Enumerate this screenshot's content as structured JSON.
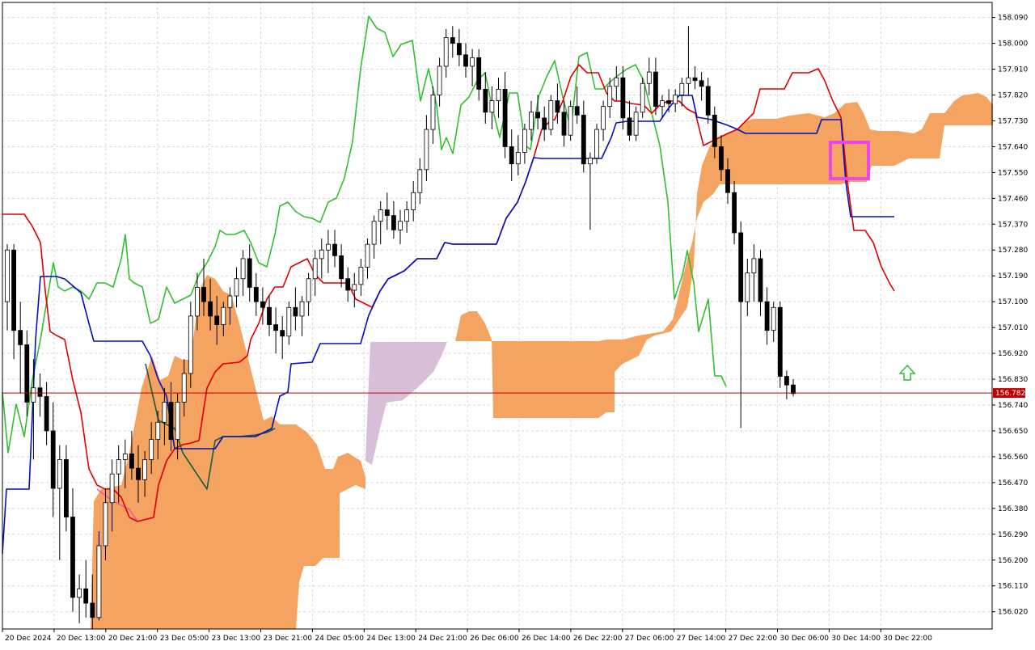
{
  "chart_data": {
    "type": "candlestick",
    "indicator": "ichimoku",
    "price_axis": {
      "ylim": [
        155.96,
        158.11
      ],
      "ticks": [
        "158.090",
        "158.000",
        "157.910",
        "157.820",
        "157.730",
        "157.640",
        "157.550",
        "157.460",
        "157.370",
        "157.280",
        "157.190",
        "157.100",
        "157.010",
        "156.920",
        "156.830",
        "156.740",
        "156.650",
        "156.560",
        "156.470",
        "156.380",
        "156.290",
        "156.200",
        "156.110",
        "156.020"
      ]
    },
    "time_axis": {
      "labels": [
        "20 Dec 2024",
        "20 Dec 13:00",
        "20 Dec 21:00",
        "23 Dec 05:00",
        "23 Dec 13:00",
        "23 Dec 21:00",
        "24 Dec 05:00",
        "24 Dec 13:00",
        "24 Dec 21:00",
        "26 Dec 06:00",
        "26 Dec 14:00",
        "26 Dec 22:00",
        "27 Dec 06:00",
        "27 Dec 14:00",
        "27 Dec 22:00",
        "30 Dec 06:00",
        "30 Dec 14:00",
        "30 Dec 22:00"
      ]
    },
    "current_price": "156.782",
    "colors": {
      "tenkan": "#e00000",
      "kijun": "#0010c0",
      "chikou": "#30c030",
      "kumo_bull": "#f4a460",
      "kumo_bear": "#d8bfd8",
      "price_line": "#c00000",
      "price_badge": "#c00000",
      "highlight_box": "#ee44ee",
      "arrow": "#30c030",
      "lagging_line": "#1a5a3a",
      "leading_line": "#ff50a0"
    },
    "candles": [
      [
        157.1,
        157.3,
        157.0,
        157.28
      ],
      [
        157.28,
        157.3,
        156.9,
        157.0
      ],
      [
        157.0,
        157.1,
        156.78,
        156.95
      ],
      [
        156.95,
        157.0,
        156.7,
        156.75
      ],
      [
        156.75,
        156.9,
        156.55,
        156.8
      ],
      [
        156.8,
        156.85,
        156.7,
        156.77
      ],
      [
        156.77,
        156.82,
        156.6,
        156.65
      ],
      [
        156.65,
        156.75,
        156.35,
        156.45
      ],
      [
        156.45,
        156.6,
        156.2,
        156.55
      ],
      [
        156.55,
        156.6,
        156.3,
        156.35
      ],
      [
        156.35,
        156.45,
        156.02,
        156.07
      ],
      [
        156.07,
        156.15,
        155.98,
        156.1
      ],
      [
        156.1,
        156.2,
        156.0,
        156.05
      ],
      [
        156.05,
        156.15,
        155.96,
        156.0
      ],
      [
        156.0,
        156.3,
        155.99,
        156.25
      ],
      [
        156.25,
        156.45,
        156.2,
        156.4
      ],
      [
        156.4,
        156.55,
        156.3,
        156.5
      ],
      [
        156.5,
        156.6,
        156.4,
        156.55
      ],
      [
        156.55,
        156.62,
        156.45,
        156.57
      ],
      [
        156.57,
        156.65,
        156.48,
        156.52
      ],
      [
        156.52,
        156.6,
        156.4,
        156.48
      ],
      [
        156.48,
        156.58,
        156.42,
        156.55
      ],
      [
        156.55,
        156.68,
        156.5,
        156.62
      ],
      [
        156.62,
        156.72,
        156.55,
        156.68
      ],
      [
        156.68,
        156.8,
        156.6,
        156.75
      ],
      [
        156.75,
        156.82,
        156.58,
        156.62
      ],
      [
        156.62,
        156.78,
        156.55,
        156.75
      ],
      [
        156.75,
        156.9,
        156.7,
        156.85
      ],
      [
        156.85,
        157.1,
        156.8,
        157.05
      ],
      [
        157.05,
        157.2,
        157.0,
        157.15
      ],
      [
        157.15,
        157.25,
        157.05,
        157.1
      ],
      [
        157.1,
        157.18,
        157.0,
        157.05
      ],
      [
        157.05,
        157.12,
        156.95,
        157.02
      ],
      [
        157.02,
        157.1,
        156.98,
        157.08
      ],
      [
        157.08,
        157.15,
        157.02,
        157.12
      ],
      [
        157.12,
        157.22,
        157.08,
        157.18
      ],
      [
        157.18,
        157.28,
        157.12,
        157.25
      ],
      [
        157.25,
        157.3,
        157.1,
        157.15
      ],
      [
        157.15,
        157.2,
        157.05,
        157.1
      ],
      [
        157.1,
        157.15,
        157.02,
        157.08
      ],
      [
        157.08,
        157.12,
        156.98,
        157.02
      ],
      [
        157.02,
        157.08,
        156.92,
        157.0
      ],
      [
        157.0,
        157.05,
        156.9,
        156.98
      ],
      [
        156.98,
        157.1,
        156.95,
        157.08
      ],
      [
        157.08,
        157.15,
        157.0,
        157.05
      ],
      [
        157.05,
        157.12,
        156.98,
        157.1
      ],
      [
        157.1,
        157.2,
        157.05,
        157.18
      ],
      [
        157.18,
        157.28,
        157.12,
        157.25
      ],
      [
        157.25,
        157.32,
        157.18,
        157.28
      ],
      [
        157.28,
        157.35,
        157.2,
        157.3
      ],
      [
        157.3,
        157.35,
        157.22,
        157.26
      ],
      [
        157.26,
        157.3,
        157.15,
        157.18
      ],
      [
        157.18,
        157.22,
        157.1,
        157.14
      ],
      [
        157.14,
        157.2,
        157.08,
        157.16
      ],
      [
        157.16,
        157.25,
        157.12,
        157.22
      ],
      [
        157.22,
        157.32,
        157.18,
        157.3
      ],
      [
        157.3,
        157.4,
        157.25,
        157.38
      ],
      [
        157.38,
        157.45,
        157.3,
        157.42
      ],
      [
        157.42,
        157.48,
        157.35,
        157.4
      ],
      [
        157.4,
        157.45,
        157.32,
        157.35
      ],
      [
        157.35,
        157.42,
        157.3,
        157.38
      ],
      [
        157.38,
        157.45,
        157.34,
        157.42
      ],
      [
        157.42,
        157.52,
        157.38,
        157.48
      ],
      [
        157.48,
        157.6,
        157.44,
        157.56
      ],
      [
        157.56,
        157.75,
        157.52,
        157.7
      ],
      [
        157.7,
        157.85,
        157.65,
        157.82
      ],
      [
        157.82,
        157.95,
        157.78,
        157.92
      ],
      [
        157.92,
        158.05,
        157.88,
        158.02
      ],
      [
        158.02,
        158.06,
        157.95,
        158.0
      ],
      [
        158.0,
        158.05,
        157.92,
        157.96
      ],
      [
        157.96,
        158.0,
        157.88,
        157.92
      ],
      [
        157.92,
        157.98,
        157.85,
        157.95
      ],
      [
        157.95,
        157.98,
        157.8,
        157.84
      ],
      [
        157.84,
        157.9,
        157.72,
        157.76
      ],
      [
        157.76,
        157.85,
        157.7,
        157.8
      ],
      [
        157.8,
        157.88,
        157.74,
        157.84
      ],
      [
        157.84,
        157.9,
        157.6,
        157.64
      ],
      [
        157.64,
        157.7,
        157.52,
        157.58
      ],
      [
        157.58,
        157.68,
        157.54,
        157.62
      ],
      [
        157.62,
        157.72,
        157.58,
        157.7
      ],
      [
        157.7,
        157.8,
        157.66,
        157.76
      ],
      [
        157.76,
        157.82,
        157.7,
        157.74
      ],
      [
        157.74,
        157.78,
        157.66,
        157.7
      ],
      [
        157.7,
        157.82,
        157.68,
        157.8
      ],
      [
        157.8,
        157.86,
        157.72,
        157.76
      ],
      [
        157.76,
        157.8,
        157.64,
        157.68
      ],
      [
        157.68,
        157.8,
        157.66,
        157.78
      ],
      [
        157.78,
        157.85,
        157.72,
        157.75
      ],
      [
        157.75,
        157.8,
        157.55,
        157.58
      ],
      [
        157.58,
        157.62,
        157.35,
        157.6
      ],
      [
        157.6,
        157.72,
        157.58,
        157.7
      ],
      [
        157.7,
        157.8,
        157.66,
        157.78
      ],
      [
        157.78,
        157.88,
        157.74,
        157.85
      ],
      [
        157.85,
        157.92,
        157.8,
        157.88
      ],
      [
        157.88,
        157.92,
        157.7,
        157.74
      ],
      [
        157.74,
        157.8,
        157.66,
        157.68
      ],
      [
        157.68,
        157.78,
        157.66,
        157.76
      ],
      [
        157.76,
        157.88,
        157.74,
        157.86
      ],
      [
        157.86,
        157.95,
        157.82,
        157.9
      ],
      [
        157.9,
        157.95,
        157.75,
        157.78
      ],
      [
        157.78,
        157.82,
        157.74,
        157.8
      ],
      [
        157.8,
        157.84,
        157.76,
        157.79
      ],
      [
        157.79,
        157.84,
        157.76,
        157.82
      ],
      [
        157.82,
        157.88,
        157.78,
        157.86
      ],
      [
        157.86,
        158.06,
        157.82,
        157.88
      ],
      [
        157.88,
        157.92,
        157.84,
        157.87
      ],
      [
        157.87,
        157.9,
        157.8,
        157.85
      ],
      [
        157.85,
        157.88,
        157.72,
        157.75
      ],
      [
        157.75,
        157.78,
        157.6,
        157.64
      ],
      [
        157.64,
        157.68,
        157.52,
        157.56
      ],
      [
        157.56,
        157.6,
        157.44,
        157.48
      ],
      [
        157.48,
        157.52,
        157.3,
        157.34
      ],
      [
        157.34,
        157.38,
        156.66,
        157.1
      ],
      [
        157.1,
        157.25,
        157.05,
        157.2
      ],
      [
        157.2,
        157.3,
        157.1,
        157.25
      ],
      [
        157.25,
        157.28,
        157.05,
        157.1
      ],
      [
        157.1,
        157.15,
        156.95,
        157.0
      ],
      [
        157.0,
        157.1,
        156.96,
        157.08
      ],
      [
        157.08,
        157.1,
        156.8,
        156.84
      ],
      [
        156.84,
        156.86,
        156.76,
        156.81
      ],
      [
        156.81,
        156.83,
        156.77,
        156.78
      ]
    ]
  }
}
